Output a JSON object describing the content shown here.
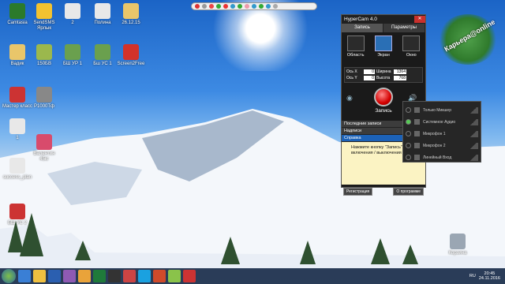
{
  "desktop_icons": [
    {
      "label": "Camtasia",
      "color": "#2b7a2b"
    },
    {
      "label": "SendSMS Ярлык",
      "color": "#f2c230"
    },
    {
      "label": "2",
      "color": "#e8e8e8"
    },
    {
      "label": "Полина",
      "color": "#e8e8e8"
    },
    {
      "label": "26.12.15",
      "color": "#e9c66a"
    },
    {
      "label": "Вадик",
      "color": "#e9c66a"
    },
    {
      "label": "150БВ",
      "color": "#9bb84d"
    },
    {
      "label": "БШ УР 1",
      "color": "#6aa04e"
    },
    {
      "label": "Бш УС 1",
      "color": "#6aa04e"
    },
    {
      "label": "Screen2Free",
      "color": "#d3322a"
    },
    {
      "label": "Мастер класс",
      "color": "#cc3333"
    },
    {
      "label": "Р1000Тф",
      "color": "#888"
    },
    {
      "label": "1",
      "color": "#e8e8e8"
    },
    {
      "label": "Валентин 45кг",
      "color": "#d84b6c"
    },
    {
      "label": "success_plan",
      "color": "#e8e8e8"
    },
    {
      "label": "БШ УС 2",
      "color": "#cc3333"
    },
    {
      "label": "Корзина",
      "color": "#9aa6b3"
    }
  ],
  "watermark_text": "Карьера@online",
  "hypercam": {
    "title": "HyperCam 4.0",
    "close": "✕",
    "tabs": [
      {
        "label": "Запись"
      },
      {
        "label": "Параметры"
      }
    ],
    "modes": [
      {
        "label": "Область"
      },
      {
        "label": "Экран"
      },
      {
        "label": "Окно"
      }
    ],
    "coords": {
      "x_label": "Ось X",
      "x": "0",
      "w_label": "Ширина",
      "w": "1364",
      "y_label": "Ось Y",
      "y": "0",
      "h_label": "Высота",
      "h": "768"
    },
    "record_label": "Запись",
    "accordion": [
      {
        "label": "Последние записи"
      },
      {
        "label": "Надписи"
      },
      {
        "label": "Справка"
      }
    ],
    "help_text": "Нажмите кнопку \"Запись\" з... включения / выключения зап...",
    "footer": {
      "register": "Регистрация",
      "about": "О программе"
    }
  },
  "audio_menu": [
    {
      "label": "Только Микшер",
      "on": false
    },
    {
      "label": "Системное Аудио",
      "on": true
    },
    {
      "label": "Микрофон 1",
      "on": false
    },
    {
      "label": "Микрофон 2",
      "on": false
    },
    {
      "label": "Линейный Вход",
      "on": false
    }
  ],
  "tray": {
    "lang": "RU",
    "time": "20:45",
    "date": "24.11.2016"
  }
}
